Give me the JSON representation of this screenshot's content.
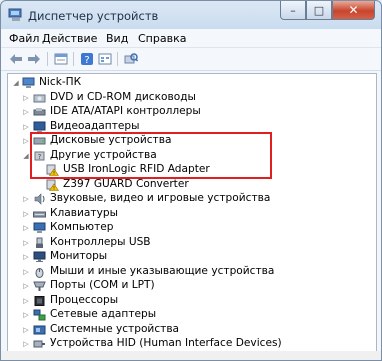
{
  "window": {
    "title": "Диспетчер устройств",
    "caption": {
      "minimize": "–",
      "maximize": "□",
      "close": "✕"
    }
  },
  "menu": [
    "Файл",
    "Действие",
    "Вид",
    "Справка"
  ],
  "toolbar": [
    "back-arrow-icon",
    "forward-arrow-icon",
    "properties-icon",
    "help-icon",
    "view-icon",
    "scan-hardware-icon"
  ],
  "tree": {
    "root": "Nick-ПК",
    "items": [
      {
        "label": "DVD и CD-ROM дисководы",
        "icon": "dvd-drive-icon"
      },
      {
        "label": "IDE ATA/ATAPI контроллеры",
        "icon": "ide-controller-icon"
      },
      {
        "label": "Видеоадаптеры",
        "icon": "video-adapter-icon"
      },
      {
        "label": "Дисковые устройства",
        "icon": "disk-drive-icon"
      },
      {
        "label": "Другие устройства",
        "icon": "other-devices-icon",
        "expanded": true,
        "children": [
          {
            "label": "USB IronLogic RFID Adapter",
            "icon": "warning-device-icon"
          },
          {
            "label": "Z397 GUARD Converter",
            "icon": "warning-device-icon"
          }
        ]
      },
      {
        "label": "Звуковые, видео и игровые устройства",
        "icon": "sound-icon"
      },
      {
        "label": "Клавиатуры",
        "icon": "keyboard-icon"
      },
      {
        "label": "Компьютер",
        "icon": "computer-icon"
      },
      {
        "label": "Контроллеры USB",
        "icon": "usb-icon"
      },
      {
        "label": "Мониторы",
        "icon": "monitor-icon"
      },
      {
        "label": "Мыши и иные указывающие устройства",
        "icon": "mouse-icon"
      },
      {
        "label": "Порты (COM и LPT)",
        "icon": "port-icon"
      },
      {
        "label": "Процессоры",
        "icon": "processor-icon"
      },
      {
        "label": "Сетевые адаптеры",
        "icon": "network-icon"
      },
      {
        "label": "Системные устройства",
        "icon": "system-icon"
      },
      {
        "label": "Устройства HID (Human Interface Devices)",
        "icon": "hid-icon"
      }
    ]
  },
  "colors": {
    "highlight_border": "#e02020",
    "warning": "#f2c200"
  }
}
